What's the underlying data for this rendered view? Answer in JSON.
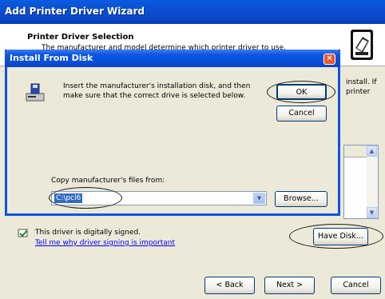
{
  "wizard": {
    "title": "Add Printer Driver Wizard",
    "header_title": "Printer Driver Selection",
    "header_subtitle": "The manufacturer and model determine which printer driver to use.",
    "bg_text_right_1": "install.  If",
    "bg_text_right_2": "printer",
    "signed_text": "This driver is digitally signed.",
    "signing_link": "Tell me why driver signing is important",
    "have_disk_label": "Have Disk...",
    "back_label": "< Back",
    "next_label": "Next >",
    "cancel_label": "Cancel"
  },
  "dialog": {
    "title": "Install From Disk",
    "message": "Insert the manufacturer's installation disk, and then make sure that the correct drive is selected below.",
    "ok_label": "OK",
    "cancel_label": "Cancel",
    "copy_label": "Copy manufacturer's files from:",
    "path_value": "C:\\pcl6",
    "browse_label": "Browse..."
  },
  "icons": [
    "printer-icon",
    "disk-drive-icon",
    "signed-driver-icon",
    "close-icon",
    "dropdown-arrow-icon",
    "scroll-up-icon",
    "scroll-down-icon"
  ],
  "colors": {
    "titlebar": "#0b4fd1",
    "window_bg": "#ece9d8",
    "link": "#0000ff",
    "selection": "#316ac5",
    "close_button": "#e65a2b"
  }
}
